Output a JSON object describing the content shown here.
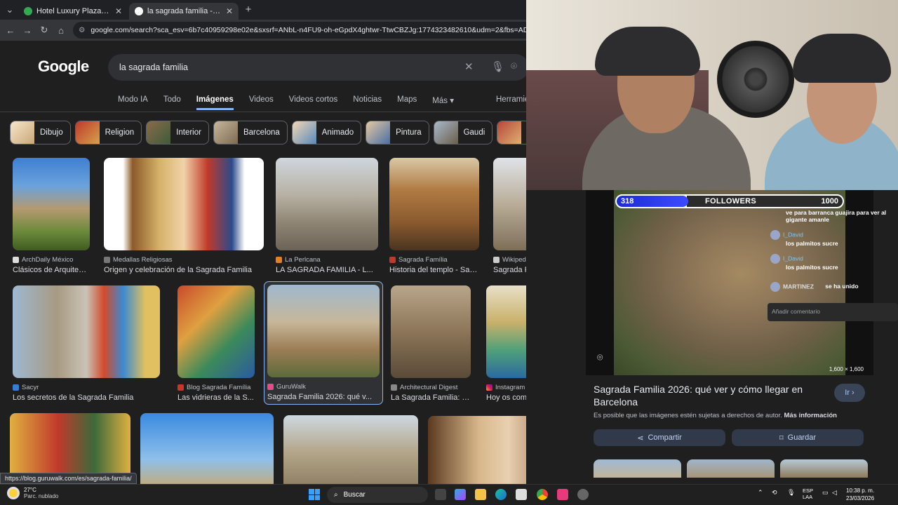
{
  "browser": {
    "tabs": [
      {
        "title": "Hotel Luxury Plaza - Google Ma",
        "active": false
      },
      {
        "title": "la sagrada familia - Buscar con",
        "active": true
      }
    ],
    "url": "google.com/search?sca_esv=6b7c40959298e02e&sxsrf=ANbL-n4FU9-oh-eGpdX4ghtwr-TtwCBZJg:1774323482610&udm=2&fbs=ADc_l-bpk8W4E-qsV"
  },
  "google": {
    "logo": "Google",
    "query": "la sagrada familia",
    "tabs": [
      "Modo IA",
      "Todo",
      "Imágenes",
      "Videos",
      "Videos cortos",
      "Noticias",
      "Maps",
      "Más ▾"
    ],
    "tools": "Herramie",
    "chips": [
      "Dibujo",
      "Religion",
      "Interior",
      "Barcelona",
      "Animado",
      "Pintura",
      "Gaudi",
      "N"
    ],
    "results_row1": [
      {
        "source": "ArchDaily México",
        "caption": "Clásicos de Arquitect..."
      },
      {
        "source": "Medallas Religiosas",
        "caption": "Origen y celebración de la Sagrada Familia"
      },
      {
        "source": "La Perlcana",
        "caption": "LA SAGRADA FAMILIA - L..."
      },
      {
        "source": "Sagrada Família",
        "caption": "Historia del templo - Sag..."
      },
      {
        "source": "Wikipedia",
        "caption": "Sagrada Família - Wi..."
      }
    ],
    "results_row2": [
      {
        "source": "Sacyr",
        "caption": "Los secretos de la Sagrada Familia"
      },
      {
        "source": "Blog Sagrada Família",
        "caption": "Las vidrieras de la S..."
      },
      {
        "source": "GuruWalk",
        "caption": "Sagrada Familia 2026: qué v..."
      },
      {
        "source": "Architectural Digest",
        "caption": "La Sagrada Familia: T..."
      },
      {
        "source": "Instagram",
        "caption": "Hoy os comparto algun..."
      }
    ],
    "hover_url": "https://blog.guruwalk.com/es/sagrada-familia/"
  },
  "panel": {
    "dims": "1,600 × 1,600",
    "title": "Sagrada Familia 2026: qué ver y cómo llegar en Barcelona",
    "go_label": "Ir ›",
    "note": "Es posible que las imágenes estén sujetas a derechos de autor.",
    "more_info": "Más información",
    "share_label": "Compartir",
    "save_label": "Guardar"
  },
  "stream": {
    "followers_current": "318",
    "followers_label": "FOLLOWERS",
    "followers_goal": "1000",
    "followers_progress": 0.318,
    "chat": [
      {
        "user": "",
        "text": "ve para barranca guajira para ver al gigante amanle"
      },
      {
        "user": "I_David",
        "text": "los palmitos sucre"
      },
      {
        "user": "I_David",
        "text": "los palmitos sucre"
      },
      {
        "user": "MARTINEZ",
        "text": "se ha unido"
      }
    ],
    "comment_placeholder": "Añadir comentario"
  },
  "taskbar": {
    "temp": "27°C",
    "weather": "Parc. nublado",
    "search": "Buscar",
    "lang1": "ESP",
    "lang2": "LAA",
    "time": "10:38 p. m.",
    "date": "23/03/2026"
  },
  "colors": {
    "accent": "#8ab4f8",
    "background": "#1f1f1f",
    "follower_bar": "#1b2bd6"
  }
}
